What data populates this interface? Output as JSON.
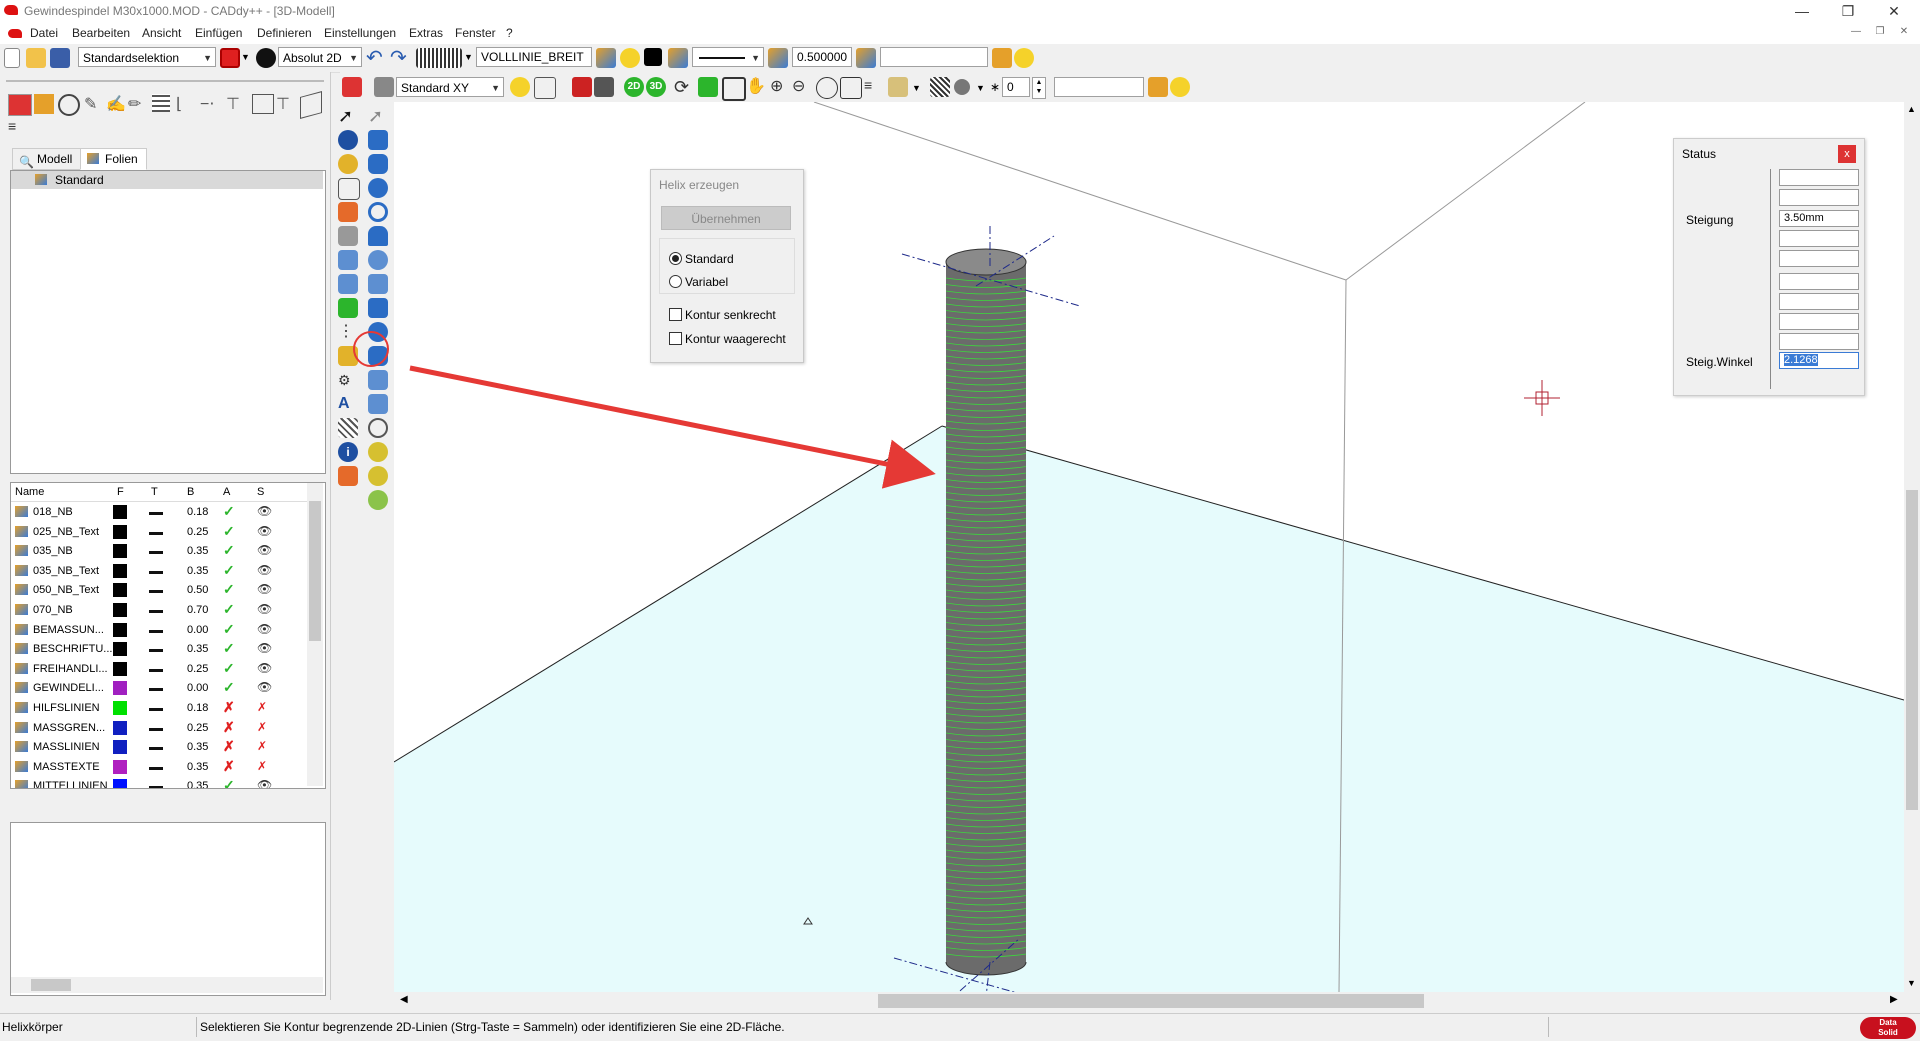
{
  "window": {
    "title": "Gewindespindel M30x1000.MOD  -  CADdy++ - [3D-Modell]"
  },
  "menu": [
    "Datei",
    "Bearbeiten",
    "Ansicht",
    "Einfügen",
    "Definieren",
    "Einstellungen",
    "Extras",
    "Fenster",
    "?"
  ],
  "toolbar1": {
    "selection_mode": "Standardselektion",
    "coord_mode": "Absolut 2D",
    "linetype": "VOLLLINIE_BREIT",
    "line_width": "0.500000",
    "extra_field": ""
  },
  "toolbar2": {
    "view_plane": "Standard XY",
    "btn_2d": "2D",
    "btn_3d": "3D",
    "step_value": "0",
    "extra_field": ""
  },
  "left_panel": {
    "tabs": [
      "Modell",
      "Folien"
    ],
    "active_tab": "Folien",
    "tree_items": [
      "Standard"
    ],
    "table_headers": [
      "Name",
      "F",
      "T",
      "B",
      "A",
      "S"
    ],
    "layers": [
      {
        "name": "018_NB",
        "color": "#000000",
        "width": "0.18",
        "active": "✓",
        "visible": "👁"
      },
      {
        "name": "025_NB_Text",
        "color": "#000000",
        "width": "0.25",
        "active": "✓",
        "visible": "👁"
      },
      {
        "name": "035_NB",
        "color": "#000000",
        "width": "0.35",
        "active": "✓",
        "visible": "👁"
      },
      {
        "name": "035_NB_Text",
        "color": "#000000",
        "width": "0.35",
        "active": "✓",
        "visible": "👁"
      },
      {
        "name": "050_NB_Text",
        "color": "#000000",
        "width": "0.50",
        "active": "✓",
        "visible": "👁"
      },
      {
        "name": "070_NB",
        "color": "#000000",
        "width": "0.70",
        "active": "✓",
        "visible": "👁"
      },
      {
        "name": "BEMASSUN...",
        "color": "#000000",
        "width": "0.00",
        "active": "✓",
        "visible": "👁"
      },
      {
        "name": "BESCHRIFTU...",
        "color": "#000000",
        "width": "0.35",
        "active": "✓",
        "visible": "👁"
      },
      {
        "name": "FREIHANDLI...",
        "color": "#000000",
        "width": "0.25",
        "active": "✓",
        "visible": "👁"
      },
      {
        "name": "GEWINDELI...",
        "color": "#a020c0",
        "width": "0.00",
        "active": "✓",
        "visible": "👁"
      },
      {
        "name": "HILFSLINIEN",
        "color": "#00e000",
        "width": "0.18",
        "active": "✗",
        "visible": "✗"
      },
      {
        "name": "MASSGREN...",
        "color": "#1020c0",
        "width": "0.25",
        "active": "✗",
        "visible": "✗"
      },
      {
        "name": "MASSLINIEN",
        "color": "#1020c0",
        "width": "0.35",
        "active": "✗",
        "visible": "✗"
      },
      {
        "name": "MASSTEXTE",
        "color": "#b020c0",
        "width": "0.35",
        "active": "✗",
        "visible": "✗"
      },
      {
        "name": "MITTELLINIEN",
        "color": "#0010ff",
        "width": "0.35",
        "active": "✓",
        "visible": "👁"
      }
    ]
  },
  "helix_dialog": {
    "title": "Helix erzeugen",
    "apply_button": "Übernehmen",
    "option_standard": "Standard",
    "option_variabel": "Variabel",
    "check_senkrecht": "Kontur senkrecht",
    "check_waagerecht": "Kontur waagerecht"
  },
  "status_panel": {
    "title": "Status",
    "close": "x",
    "steigung_label": "Steigung",
    "steigung_value": "3.50mm",
    "winkel_label": "Steig.Winkel",
    "winkel_value": "2.1268"
  },
  "statusbar": {
    "mode": "Helixkörper",
    "hint": "Selektieren Sie Kontur begrenzende 2D-Linien (Strg-Taste = Sammeln) oder identifizieren Sie eine 2D-Fläche."
  },
  "brand": {
    "logo_text_1": "Data",
    "logo_text_2": "Solid"
  },
  "colors": {
    "accent_red": "#e53935",
    "floor": "#e6fbfc",
    "thread_green": "#3cd83c"
  }
}
